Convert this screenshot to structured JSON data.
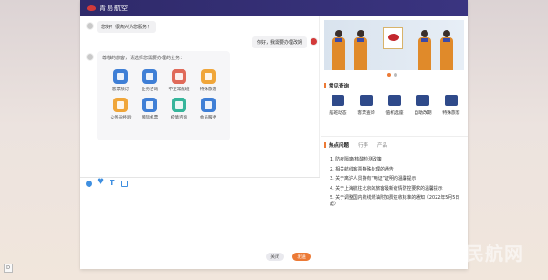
{
  "app": {
    "brand_name": "青島航空"
  },
  "chat": {
    "greeting": "您好！很高兴为您服务！",
    "user_message": "你好，我需要办理改期",
    "card_title": "尊敬的旅客，请选择您需要办理的业务：",
    "services": [
      {
        "label": "客票预订",
        "icon": "ticket-icon",
        "color": "#3f7fd6"
      },
      {
        "label": "业务咨询",
        "icon": "consult-icon",
        "color": "#3f7fd6"
      },
      {
        "label": "不正常航班",
        "icon": "abnormal-flight-icon",
        "color": "#e06a5a"
      },
      {
        "label": "特殊旅客",
        "icon": "special-passenger-icon",
        "color": "#f0a63a"
      },
      {
        "label": "公务员经验",
        "icon": "civil-servant-icon",
        "color": "#f0a63a"
      },
      {
        "label": "国际机票",
        "icon": "international-ticket-icon",
        "color": "#3f7fd6"
      },
      {
        "label": "疫情咨询",
        "icon": "epidemic-icon",
        "color": "#36b59b"
      },
      {
        "label": "会员服务",
        "icon": "member-service-icon",
        "color": "#3f7fd6"
      }
    ]
  },
  "composer": {
    "tools": [
      "smile-icon",
      "heart-icon",
      "text-icon",
      "image-icon"
    ],
    "close_label": "关闭",
    "send_label": "发送"
  },
  "sidebar": {
    "faq_title": "常见查询",
    "quick_links": [
      {
        "label": "航班动态",
        "icon": "flight-status-icon"
      },
      {
        "label": "客票查询",
        "icon": "ticket-query-icon"
      },
      {
        "label": "值机选座",
        "icon": "seat-selection-icon"
      },
      {
        "label": "自助改期",
        "icon": "self-reschedule-icon"
      },
      {
        "label": "特殊旅客",
        "icon": "special-passenger-icon"
      }
    ],
    "tabs": [
      "热点问题",
      "行李",
      "产品"
    ],
    "hot_items": [
      "1. 防疫隔离/核酸检测政策",
      "2. 相关航线客票特殊处理的通告",
      "3. 关于离沪人员持有“两证”证明的温馨提示",
      "4. 关于上海航往北京的旅客最新疫情防控要求的温馨提示",
      "5. 关于调整国内航线燃油附加费征收标准的通知（2022年5月5日起）"
    ],
    "banner_dots": 2,
    "active_dot": 0
  },
  "watermark": "中国民航网",
  "corner_label": "D",
  "colors": {
    "titlebar": "#2f2a6a",
    "accent": "#ec7a36",
    "brand": "#d33a3a"
  }
}
